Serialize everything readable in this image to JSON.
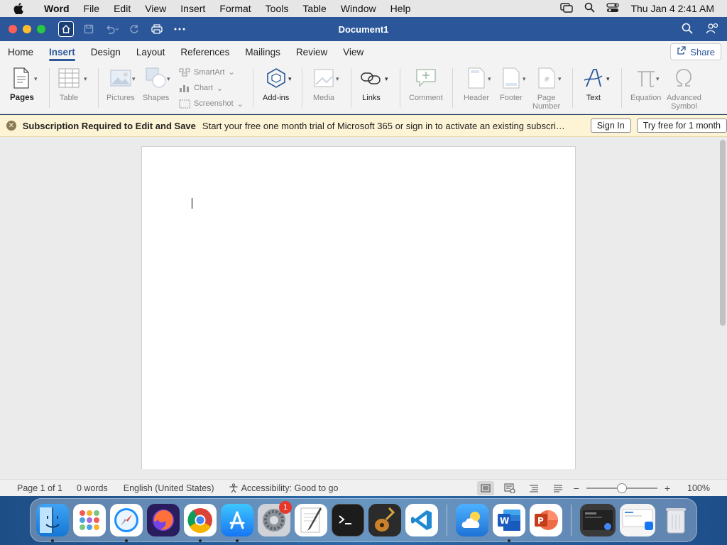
{
  "menubar": {
    "app_name": "Word",
    "items": [
      "File",
      "Edit",
      "View",
      "Insert",
      "Format",
      "Tools",
      "Table",
      "Window",
      "Help"
    ],
    "clock": "Thu Jan 4  2:41 AM"
  },
  "window": {
    "title": "Document1"
  },
  "ribbon_tabs": [
    "Home",
    "Insert",
    "Design",
    "Layout",
    "References",
    "Mailings",
    "Review",
    "View"
  ],
  "active_tab": "Insert",
  "share_label": "Share",
  "ribbon": {
    "pages": "Pages",
    "table": "Table",
    "pictures": "Pictures",
    "shapes": "Shapes",
    "smartart": "SmartArt",
    "chart": "Chart",
    "screenshot": "Screenshot",
    "addins": "Add-ins",
    "media": "Media",
    "links": "Links",
    "comment": "Comment",
    "header": "Header",
    "footer": "Footer",
    "page_number_1": "Page",
    "page_number_2": "Number",
    "text": "Text",
    "equation": "Equation",
    "advanced_symbol_1": "Advanced",
    "advanced_symbol_2": "Symbol"
  },
  "infobar": {
    "title": "Subscription Required to Edit and Save",
    "message": "Start your free one month trial of Microsoft 365 or sign in to activate an existing subscription.",
    "signin": "Sign In",
    "trial": "Try free for 1 month"
  },
  "statusbar": {
    "page": "Page 1 of 1",
    "words": "0 words",
    "language": "English (United States)",
    "accessibility": "Accessibility: Good to go",
    "zoom": "100%",
    "zoom_fraction": 0.5
  },
  "dock": {
    "badge_count": "1"
  },
  "colors": {
    "accent": "#2b579a",
    "infobar_bg": "#fdf3d5"
  }
}
